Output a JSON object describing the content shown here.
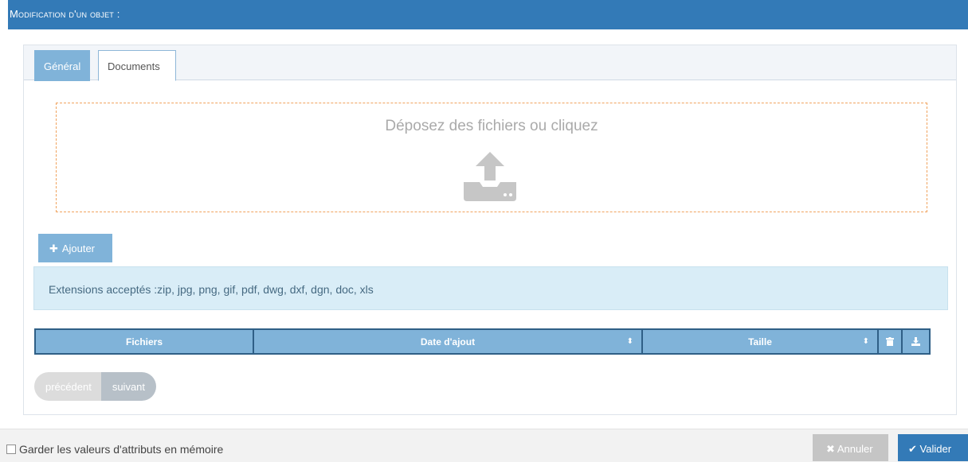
{
  "header": {
    "title": "Modification d'un objet :"
  },
  "tabs": [
    {
      "label": "Général",
      "active": false
    },
    {
      "label": "Documents",
      "active": true
    }
  ],
  "dropzone": {
    "text": "Déposez des fichiers ou cliquez",
    "icon": "upload-icon"
  },
  "add_button": {
    "icon": "plus-icon",
    "label": "Ajouter"
  },
  "extensions_info": "Extensions acceptés :zip, jpg, png, gif, pdf, dwg, dxf, dgn, doc, xls",
  "table": {
    "columns": [
      {
        "label": "Fichiers",
        "sortable": false
      },
      {
        "label": "Date d'ajout",
        "sortable": true
      },
      {
        "label": "Taille",
        "sortable": true
      }
    ],
    "action_icons": [
      "trash-icon",
      "download-icon"
    ],
    "rows": []
  },
  "pagination": {
    "previous": "précédent",
    "next": "suivant"
  },
  "footer": {
    "keep_values_label": "Garder les valeurs d'attributs en mémoire",
    "keep_values_checked": false,
    "cancel_label": "Annuler",
    "validate_label": "Valider"
  },
  "colors": {
    "primary": "#337ab7",
    "tab_accent": "#80b3d9",
    "dropzone_border": "#f0a35e",
    "info_bg": "#d9edf7",
    "cancel_bg": "#c5c5c5"
  }
}
